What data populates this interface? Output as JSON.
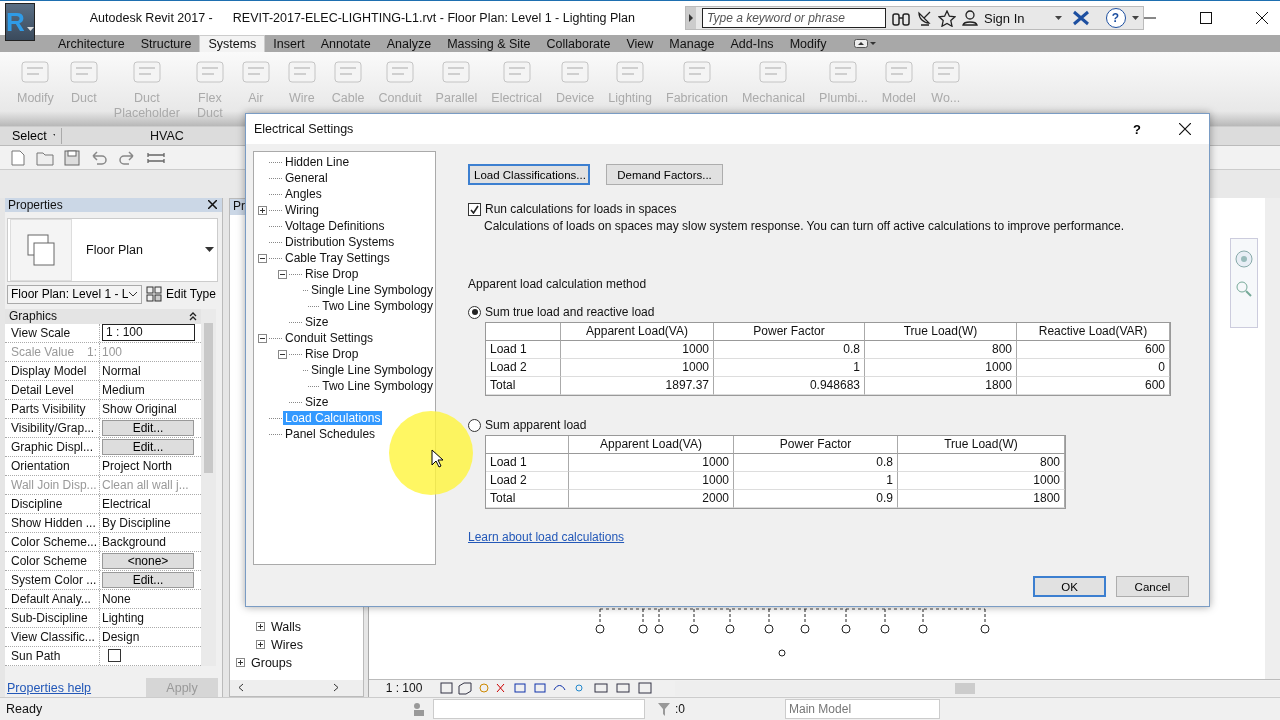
{
  "app": {
    "logo": "R",
    "title_app": "Autodesk Revit 2017 -",
    "title_doc": "REVIT-2017-ELEC-LIGHTING-L1.rvt - Floor Plan: Level 1 - Lighting Plan",
    "search": {
      "placeholder": "Type a keyword or phrase"
    },
    "sign_in": "Sign In",
    "help": "?"
  },
  "ribbon_tabs": [
    {
      "label": "Architecture",
      "selected": false
    },
    {
      "label": "Structure",
      "selected": false
    },
    {
      "label": "Systems",
      "selected": true
    },
    {
      "label": "Insert",
      "selected": false
    },
    {
      "label": "Annotate",
      "selected": false
    },
    {
      "label": "Analyze",
      "selected": false
    },
    {
      "label": "Massing & Site",
      "selected": false
    },
    {
      "label": "Collaborate",
      "selected": false
    },
    {
      "label": "View",
      "selected": false
    },
    {
      "label": "Manage",
      "selected": false
    },
    {
      "label": "Add-Ins",
      "selected": false
    },
    {
      "label": "Modify",
      "selected": false
    }
  ],
  "ribbon_buttons": [
    {
      "lines": [
        "Modify"
      ]
    },
    {
      "lines": [
        "Duct"
      ]
    },
    {
      "lines": [
        "Duct",
        "Placeholder"
      ]
    },
    {
      "lines": [
        "Flex",
        "Duct"
      ]
    },
    {
      "lines": [
        "Air"
      ]
    },
    {
      "lines": [
        "Wire"
      ]
    },
    {
      "lines": [
        "Cable"
      ]
    },
    {
      "lines": [
        "Conduit"
      ]
    },
    {
      "lines": [
        "Parallel"
      ]
    },
    {
      "lines": [
        "Electrical"
      ]
    },
    {
      "lines": [
        "Device"
      ]
    },
    {
      "lines": [
        "Lighting"
      ]
    },
    {
      "lines": [
        "Fabrication"
      ]
    },
    {
      "lines": [
        "Mechanical"
      ]
    },
    {
      "lines": [
        "Plumbi..."
      ]
    },
    {
      "lines": [
        "Model"
      ]
    },
    {
      "lines": [
        "Wo..."
      ]
    }
  ],
  "ribbon_panels": [
    {
      "label": "Select"
    },
    {
      "label": "HVAC"
    }
  ],
  "properties": {
    "title": "Properties",
    "type_name": "Floor Plan",
    "view_selector": "Floor Plan: Level 1 - L",
    "edit_type": "Edit Type",
    "group": "Graphics",
    "rows": [
      {
        "name": "View Scale",
        "value": "1 : 100",
        "kind": "input",
        "disabled": false
      },
      {
        "name": "Scale Value",
        "suffix": "1:",
        "value": "100",
        "kind": "text",
        "disabled": true
      },
      {
        "name": "Display Model",
        "value": "Normal",
        "kind": "text",
        "disabled": false
      },
      {
        "name": "Detail Level",
        "value": "Medium",
        "kind": "text",
        "disabled": false
      },
      {
        "name": "Parts Visibility",
        "value": "Show Original",
        "kind": "text",
        "disabled": false
      },
      {
        "name": "Visibility/Grap...",
        "value": "Edit...",
        "kind": "button",
        "disabled": false
      },
      {
        "name": "Graphic Displ...",
        "value": "Edit...",
        "kind": "button",
        "disabled": false
      },
      {
        "name": "Orientation",
        "value": "Project North",
        "kind": "text",
        "disabled": false
      },
      {
        "name": "Wall Join Disp...",
        "value": "Clean all wall j...",
        "kind": "text",
        "disabled": true
      },
      {
        "name": "Discipline",
        "value": "Electrical",
        "kind": "text",
        "disabled": false
      },
      {
        "name": "Show Hidden ...",
        "value": "By Discipline",
        "kind": "text",
        "disabled": false
      },
      {
        "name": "Color Scheme...",
        "value": "Background",
        "kind": "text",
        "disabled": false
      },
      {
        "name": "Color Scheme",
        "value": "<none>",
        "kind": "button",
        "disabled": false
      },
      {
        "name": "System Color ...",
        "value": "Edit...",
        "kind": "button",
        "disabled": false
      },
      {
        "name": "Default Analy...",
        "value": "None",
        "kind": "text",
        "disabled": false
      },
      {
        "name": "Sub-Discipline",
        "value": "Lighting",
        "kind": "text",
        "disabled": false
      },
      {
        "name": "View Classific...",
        "value": "Design",
        "kind": "text",
        "disabled": false
      },
      {
        "name": "Sun Path",
        "checked": false,
        "kind": "checkbox",
        "disabled": false
      }
    ],
    "help_link": "Properties help",
    "apply": "Apply"
  },
  "browser": {
    "title": "Pr",
    "items": [
      {
        "label": "Walls",
        "kind": "child"
      },
      {
        "label": "Wires",
        "kind": "child"
      },
      {
        "label": "Groups",
        "kind": "root"
      }
    ]
  },
  "view_bar": {
    "scale": "1 : 100"
  },
  "status_bar": {
    "text": "Ready",
    "count": ":0",
    "model": "Main Model"
  },
  "dialog": {
    "title": "Electrical Settings",
    "help": "?",
    "tree": [
      {
        "label": "Hidden Line",
        "selected": false
      },
      {
        "label": "General",
        "selected": false
      },
      {
        "label": "Angles",
        "selected": false
      },
      {
        "label": "Wiring",
        "selected": false,
        "expanded": false
      },
      {
        "label": "Voltage Definitions",
        "selected": false
      },
      {
        "label": "Distribution Systems",
        "selected": false
      },
      {
        "label": "Cable Tray Settings",
        "selected": false,
        "expanded": true,
        "children": [
          {
            "label": "Rise Drop",
            "selected": false,
            "expanded": true,
            "children": [
              {
                "label": "Single Line Symbology",
                "selected": false
              },
              {
                "label": "Two Line Symbology",
                "selected": false
              }
            ]
          },
          {
            "label": "Size",
            "selected": false
          }
        ]
      },
      {
        "label": "Conduit Settings",
        "selected": false,
        "expanded": true,
        "children": [
          {
            "label": "Rise Drop",
            "selected": false,
            "expanded": true,
            "children": [
              {
                "label": "Single Line Symbology",
                "selected": false
              },
              {
                "label": "Two Line Symbology",
                "selected": false
              }
            ]
          },
          {
            "label": "Size",
            "selected": false
          }
        ]
      },
      {
        "label": "Load Calculations",
        "selected": true
      },
      {
        "label": "Panel Schedules",
        "selected": false
      }
    ],
    "top_buttons": [
      "Load Classifications...",
      "Demand Factors..."
    ],
    "run_calc": {
      "label": "Run calculations for loads in spaces",
      "checked": true,
      "note": "Calculations of loads on spaces may slow system response. You can turn off active calculations to improve performance."
    },
    "method_label": "Apparent load calculation method",
    "methods": [
      {
        "label": "Sum true load and reactive load",
        "selected": true,
        "columns": [
          "Apparent Load(VA)",
          "Power Factor",
          "True Load(W)",
          "Reactive Load(VAR)"
        ],
        "rows": [
          {
            "label": "Load 1",
            "values": [
              "1000",
              "0.8",
              "800",
              "600"
            ]
          },
          {
            "label": "Load 2",
            "values": [
              "1000",
              "1",
              "1000",
              "0"
            ]
          },
          {
            "label": "Total",
            "values": [
              "1897.37",
              "0.948683",
              "1800",
              "600"
            ]
          }
        ]
      },
      {
        "label": "Sum apparent load",
        "selected": false,
        "columns": [
          "Apparent Load(VA)",
          "Power Factor",
          "True Load(W)"
        ],
        "rows": [
          {
            "label": "Load 1",
            "values": [
              "1000",
              "0.8",
              "800"
            ]
          },
          {
            "label": "Load 2",
            "values": [
              "1000",
              "1",
              "1000"
            ]
          },
          {
            "label": "Total",
            "values": [
              "2000",
              "0.9",
              "1800"
            ]
          }
        ]
      }
    ],
    "link": "Learn about load calculations",
    "ok": "OK",
    "cancel": "Cancel"
  }
}
